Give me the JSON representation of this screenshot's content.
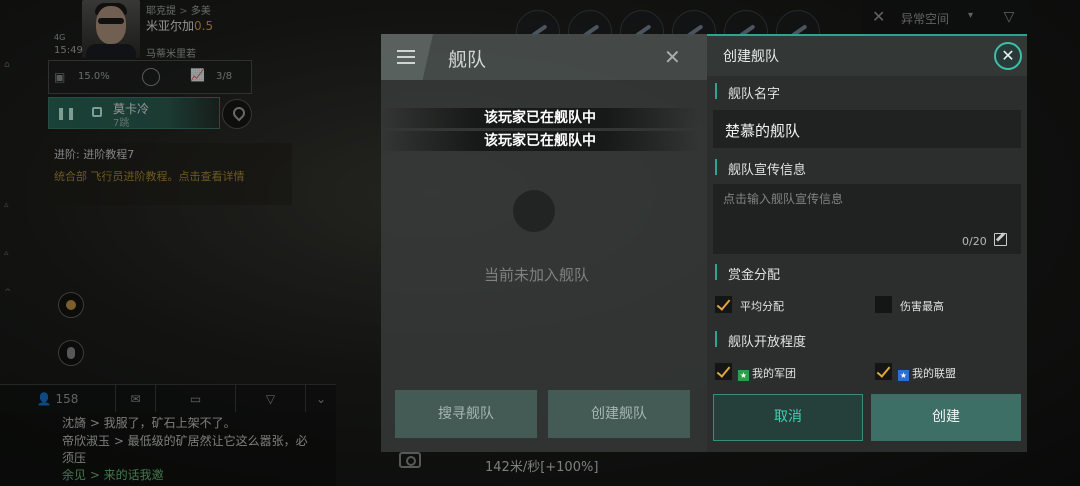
{
  "hud": {
    "corp": "耶克提",
    "region": "多美",
    "system": "米亚尔加",
    "security": "0.5",
    "signal": "4G",
    "time": "15:49",
    "location": "马蒂米里若",
    "stat1": "15.0%",
    "stat3": "3/8",
    "route_name": "莫卡冷",
    "route_sub": "7跳",
    "mission_title": "进阶: 进阶教程7",
    "mission_desc": "统合部 飞行员进阶教程。点击查看详情",
    "chat_count": "158",
    "chat": [
      {
        "text": "沈旖 > 我服了，矿石上架不了。",
        "style": "normal"
      },
      {
        "text": "帝欣淑玉 > 最低级的矿居然让它这么嚣张，必",
        "style": "normal"
      },
      {
        "text": "须压",
        "style": "normal"
      },
      {
        "text": "余见 > 来的话我邀",
        "style": "green"
      }
    ],
    "speed": "142米/秒[+100%]",
    "anomaly": "异常空间"
  },
  "fleet_panel": {
    "title": "舰队",
    "empty_text": "当前未加入舰队",
    "search_button": "搜寻舰队",
    "create_button": "创建舰队"
  },
  "toasts": [
    "该玩家已在舰队中",
    "该玩家已在舰队中"
  ],
  "dialog": {
    "title": "创建舰队",
    "name_label": "舰队名字",
    "name_value": "楚慕的舰队",
    "desc_label": "舰队宣传信息",
    "desc_placeholder": "点击输入舰队宣传信息",
    "desc_count": "0/20",
    "bounty_label": "赏金分配",
    "bounty_options": [
      {
        "label": "平均分配",
        "checked": true
      },
      {
        "label": "伤害最高",
        "checked": false
      }
    ],
    "open_label": "舰队开放程度",
    "open_options": [
      {
        "label": "我的军团",
        "checked": true,
        "badge": "green"
      },
      {
        "label": "我的联盟",
        "checked": true,
        "badge": "blue"
      }
    ],
    "cancel": "取消",
    "confirm": "创建"
  },
  "colors": {
    "accent": "#2fa391",
    "check": "#e2a63a",
    "security": "#d4a441"
  }
}
